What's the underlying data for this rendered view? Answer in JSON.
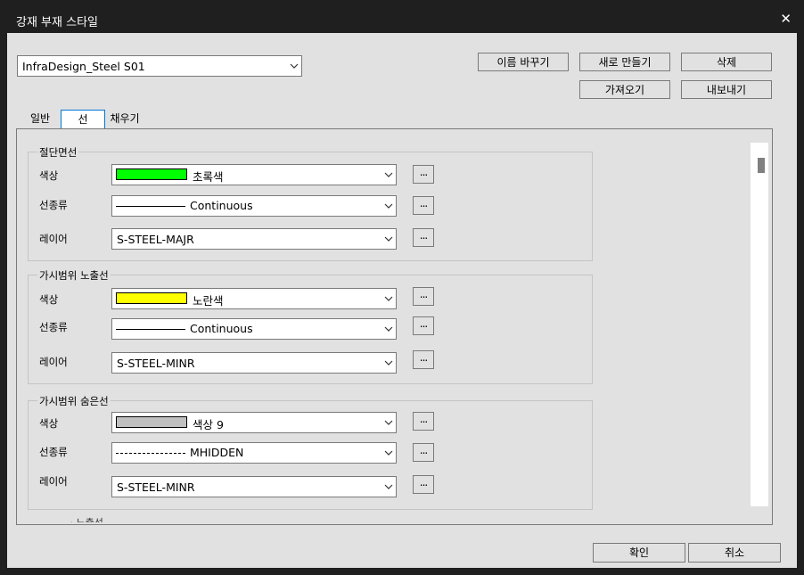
{
  "window": {
    "title": "강재 부재 스타일"
  },
  "style_selector": {
    "value": "InfraDesign_Steel S01"
  },
  "top_buttons": {
    "rename": "이름 바꾸기",
    "new": "새로 만들기",
    "delete": "삭제",
    "import": "가져오기",
    "export": "내보내기"
  },
  "tabs": [
    {
      "label": "일반"
    },
    {
      "label": "선"
    },
    {
      "label": "채우기"
    }
  ],
  "groups": [
    {
      "title": "절단면선",
      "rows": [
        {
          "label": "색상",
          "value": "초록색",
          "swatch": "#00ff00"
        },
        {
          "label": "선종류",
          "value": "Continuous"
        },
        {
          "label": "레이어",
          "value": "S-STEEL-MAJR"
        }
      ]
    },
    {
      "title": "가시범위 노출선",
      "rows": [
        {
          "label": "색상",
          "value": "노란색",
          "swatch": "#ffff00"
        },
        {
          "label": "선종류",
          "value": "Continuous"
        },
        {
          "label": "레이어",
          "value": "S-STEEL-MINR"
        }
      ]
    },
    {
      "title": "가시범위 숨은선",
      "rows": [
        {
          "label": "색상",
          "value": "색상 9",
          "swatch": "#c0c0c0"
        },
        {
          "label": "선종류",
          "value": "MHIDDEN"
        },
        {
          "label": "레이어",
          "value": "S-STEEL-MINR"
        }
      ]
    }
  ],
  "ellipsis": "...",
  "footer": {
    "ok": "확인",
    "cancel": "취소"
  }
}
